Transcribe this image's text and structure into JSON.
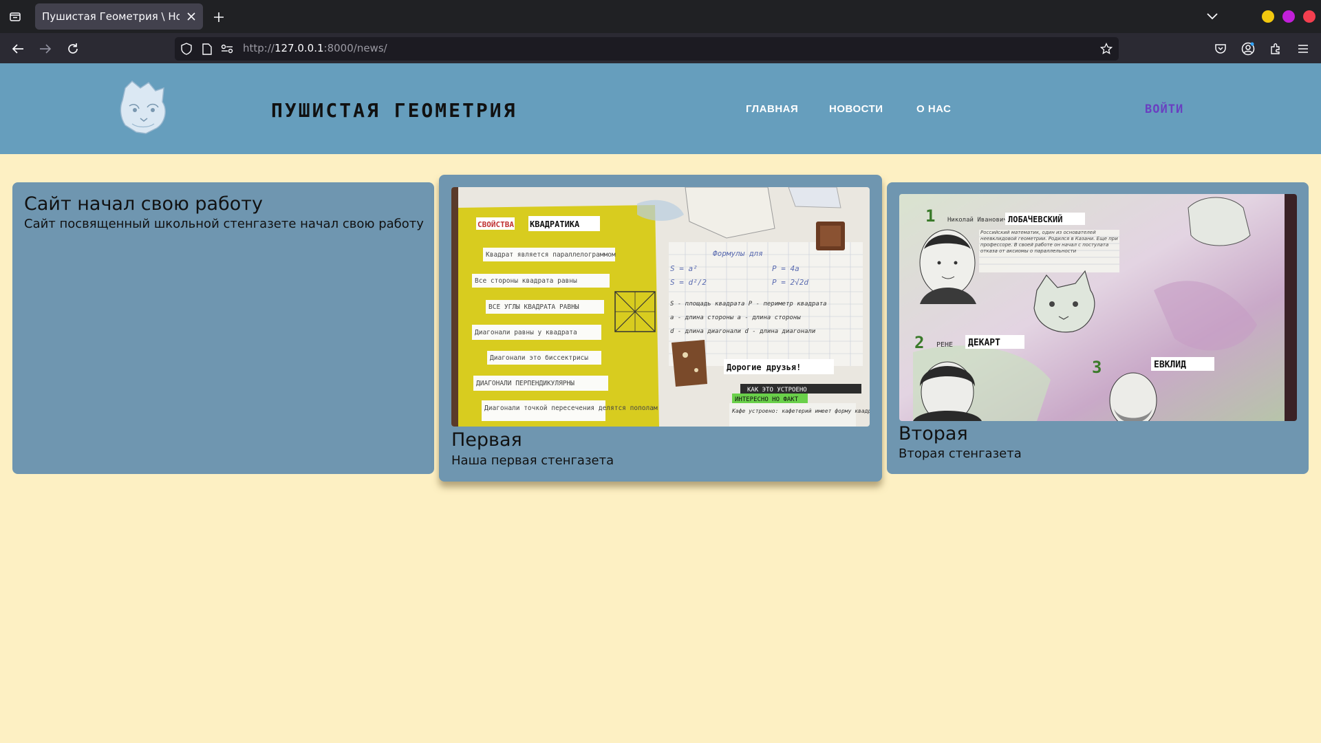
{
  "browser": {
    "tab_title": "Пушистая Геометрия \\ Новости",
    "url_prefix": "http://",
    "url_host": "127.0.0.1",
    "url_rest": ":8000/news/"
  },
  "site": {
    "title": "ПУШИСТАЯ ГЕОМЕТРИЯ",
    "menu": [
      "ГЛАВНАЯ",
      "НОВОСТИ",
      "О НАС"
    ],
    "login": "ВОЙТИ"
  },
  "news": [
    {
      "title": "Сайт начал свою работу",
      "text": "Сайт посвященный школьной стенгазете начал свою работу"
    },
    {
      "title": "Первая",
      "text": "Наша первая стенгазета",
      "image": {
        "heading": "СВОЙСТВА КВАДРАТИКА",
        "items": [
          "Квадрат является параллелограммом",
          "Все стороны квадрата равны",
          "ВСЕ УГЛЫ КВАДРАТА РАВНЫ",
          "Диагонали равны у квадрата",
          "Диагонали это биссектрисы",
          "ДИАГОНАЛИ ПЕРПЕНДИКУЛЯРНЫ",
          "Диагонали точкой пересечения делятся пополам"
        ],
        "formulas_heading": "Формулы для",
        "formulas": [
          "S = a²",
          "P = 4a",
          "S = d²/2",
          "P = 2√2d"
        ],
        "legend": [
          "S - площадь квадрата   P - периметр квадрата",
          "a - длина стороны   a - длина стороны",
          "d - длина диагонали   d - длина диагонали"
        ],
        "note_heading": "Дорогие друзья!",
        "note_sub": "КАК ЭТО УСТРОЕНО",
        "note_tag": "ИНТЕРЕСНО НО ФАКТ",
        "note_text": "Кафе устроено: кафетерий имеет форму квадрата, так как плитка"
      }
    },
    {
      "title": "Вторая",
      "text": "Вторая стенгазета",
      "image": {
        "n1": "1",
        "name1_small": "Николай Иванович",
        "name1": "ЛОБАЧЕВСКИЙ",
        "bio1": "Российский математик, один из основателей неевклидовой геометрии. Родился в Казани. Еще при профессоре. В своей работе он начал с постулата отказа от аксиомы о параллельности",
        "n2": "2",
        "name2_small": "РЕНЕ",
        "name2": "ДЕКАРТ",
        "n3": "3",
        "name3": "ЕВКЛИД"
      }
    }
  ],
  "colors": {
    "page_bg": "#fdf0c3",
    "header_bg": "#669ebd",
    "card_bg": "#6f96b0",
    "login": "#6a3fc1"
  }
}
